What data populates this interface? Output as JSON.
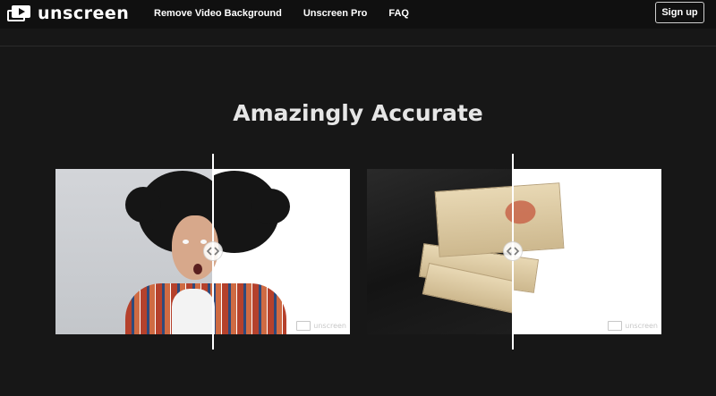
{
  "header": {
    "logo_text": "unscreen",
    "logo_icon": "video-screen-icon",
    "nav": [
      {
        "label": "Remove Video Background"
      },
      {
        "label": "Unscreen Pro"
      },
      {
        "label": "FAQ"
      }
    ],
    "signup_label": "Sign up"
  },
  "main": {
    "heading": "Amazingly Accurate"
  },
  "comparisons": [
    {
      "subject": "person with wild hair",
      "before_background": "grey wall",
      "after_background": "white",
      "slider_position_fraction": 0.54,
      "handle_icon": "left-right-arrows-icon",
      "watermark_icon": "unscreen-logo-icon"
    },
    {
      "subject": "stack of old books",
      "before_background": "dark table",
      "after_background": "white",
      "slider_position_fraction": 0.49,
      "handle_icon": "left-right-arrows-icon",
      "watermark_icon": "unscreen-logo-icon"
    }
  ],
  "colors": {
    "page_background": "#171717",
    "header_background": "#101010",
    "heading_text": "#e6e6e6",
    "signup_border": "#cfcfcf"
  }
}
